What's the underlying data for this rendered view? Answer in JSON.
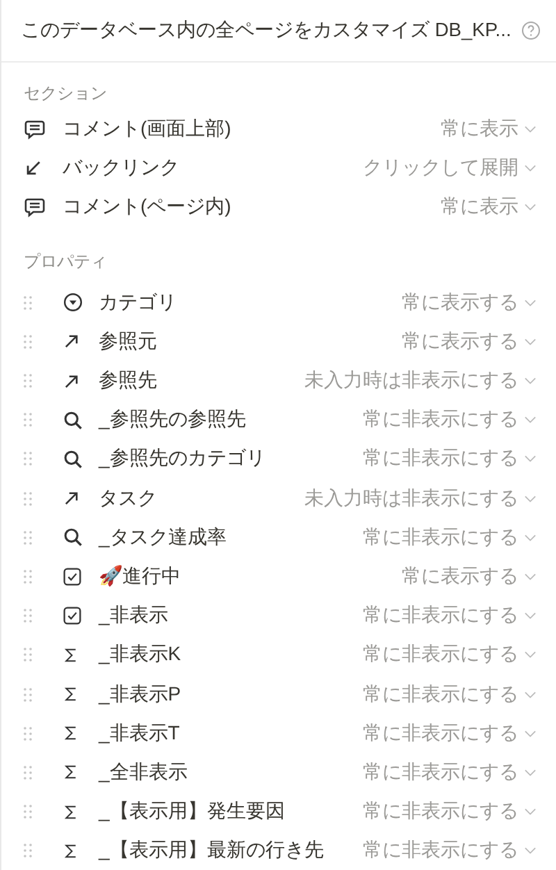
{
  "header": {
    "title": "このデータベース内の全ページをカスタマイズ DB_KP..."
  },
  "sections": {
    "label": "セクション",
    "items": [
      {
        "kind": "comment",
        "name": "コメント(画面上部)",
        "visibility": "常に表示"
      },
      {
        "kind": "backlink",
        "name": "バックリンク",
        "visibility": "クリックして展開"
      },
      {
        "kind": "comment",
        "name": "コメント(ページ内)",
        "visibility": "常に表示"
      }
    ]
  },
  "properties": {
    "label": "プロパティ",
    "items": [
      {
        "kind": "select",
        "name": "カテゴリ",
        "visibility": "常に表示する"
      },
      {
        "kind": "relation",
        "name": "参照元",
        "visibility": "常に表示する"
      },
      {
        "kind": "relation",
        "name": "参照先",
        "visibility": "未入力時は非表示にする"
      },
      {
        "kind": "rollup",
        "name": "_参照先の参照先",
        "visibility": "常に非表示にする"
      },
      {
        "kind": "rollup",
        "name": "_参照先のカテゴリ",
        "visibility": "常に非表示にする"
      },
      {
        "kind": "relation",
        "name": "タスク",
        "visibility": "未入力時は非表示にする"
      },
      {
        "kind": "rollup",
        "name": "_タスク達成率",
        "visibility": "常に非表示にする"
      },
      {
        "kind": "checkbox",
        "name": "🚀進行中",
        "visibility": "常に表示する"
      },
      {
        "kind": "checkbox",
        "name": "_非表示",
        "visibility": "常に非表示にする"
      },
      {
        "kind": "formula",
        "name": "_非表示K",
        "visibility": "常に非表示にする"
      },
      {
        "kind": "formula",
        "name": "_非表示P",
        "visibility": "常に非表示にする"
      },
      {
        "kind": "formula",
        "name": "_非表示T",
        "visibility": "常に非表示にする"
      },
      {
        "kind": "formula",
        "name": "_全非表示",
        "visibility": "常に非表示にする"
      },
      {
        "kind": "formula",
        "name": "_【表示用】発生要因",
        "visibility": "常に非表示にする"
      },
      {
        "kind": "formula",
        "name": "_【表示用】最新の行き先",
        "visibility": "常に非表示にする"
      }
    ]
  }
}
